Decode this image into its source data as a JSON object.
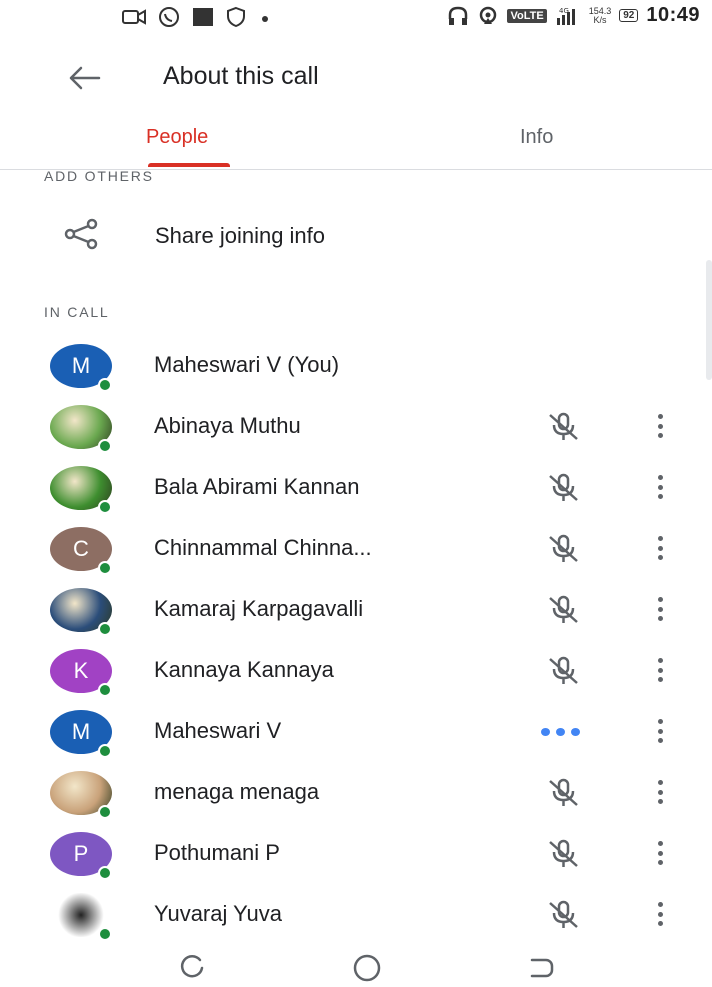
{
  "status_bar": {
    "time": "10:49",
    "network": "VoLTE",
    "speed_value": "154.3",
    "speed_unit": "K/s",
    "battery": "92",
    "signal_label": "4G"
  },
  "app_bar": {
    "title": "About this call",
    "back_icon": "arrow-back-icon"
  },
  "tabs": [
    {
      "label": "People",
      "selected": true
    },
    {
      "label": "Info",
      "selected": false
    }
  ],
  "add_others": {
    "heading": "ADD OTHERS",
    "share_label": "Share joining info",
    "share_icon": "share-icon"
  },
  "in_call": {
    "heading": "IN CALL",
    "participants": [
      {
        "name": "Maheswari V (You)",
        "initial": "M",
        "avatar_color": "#1a5fb4",
        "photo": false,
        "status": "none"
      },
      {
        "name": "Abinaya Muthu",
        "initial": "",
        "avatar_color": "#6aa84f",
        "photo": true,
        "status": "muted"
      },
      {
        "name": "Bala Abirami Kannan",
        "initial": "",
        "avatar_color": "#3e8e2f",
        "photo": true,
        "status": "muted"
      },
      {
        "name": "Chinnammal Chinna...",
        "initial": "C",
        "avatar_color": "#8d6e63",
        "photo": false,
        "status": "muted"
      },
      {
        "name": "Kamaraj Karpagavalli",
        "initial": "",
        "avatar_color": "#2b4d7a",
        "photo": true,
        "status": "muted"
      },
      {
        "name": "Kannaya Kannaya",
        "initial": "K",
        "avatar_color": "#a142c4",
        "photo": false,
        "status": "muted"
      },
      {
        "name": "Maheswari V",
        "initial": "M",
        "avatar_color": "#1a5fb4",
        "photo": false,
        "status": "talking"
      },
      {
        "name": "menaga menaga",
        "initial": "",
        "avatar_color": "#c9a27a",
        "photo": true,
        "status": "muted"
      },
      {
        "name": "Pothumani P",
        "initial": "P",
        "avatar_color": "#7e57c2",
        "photo": false,
        "status": "muted"
      },
      {
        "name": "Yuvaraj Yuva",
        "initial": "",
        "avatar_color": "#ffffff",
        "photo": true,
        "status": "muted"
      }
    ]
  },
  "colors": {
    "accent": "#d93025",
    "presence": "#1e8e3e",
    "talking": "#4285f4",
    "icon_gray": "#5f6368"
  },
  "nav_bar": {
    "back_icon": "nav-back-icon",
    "home_icon": "nav-home-icon",
    "recents_icon": "nav-recents-icon"
  }
}
